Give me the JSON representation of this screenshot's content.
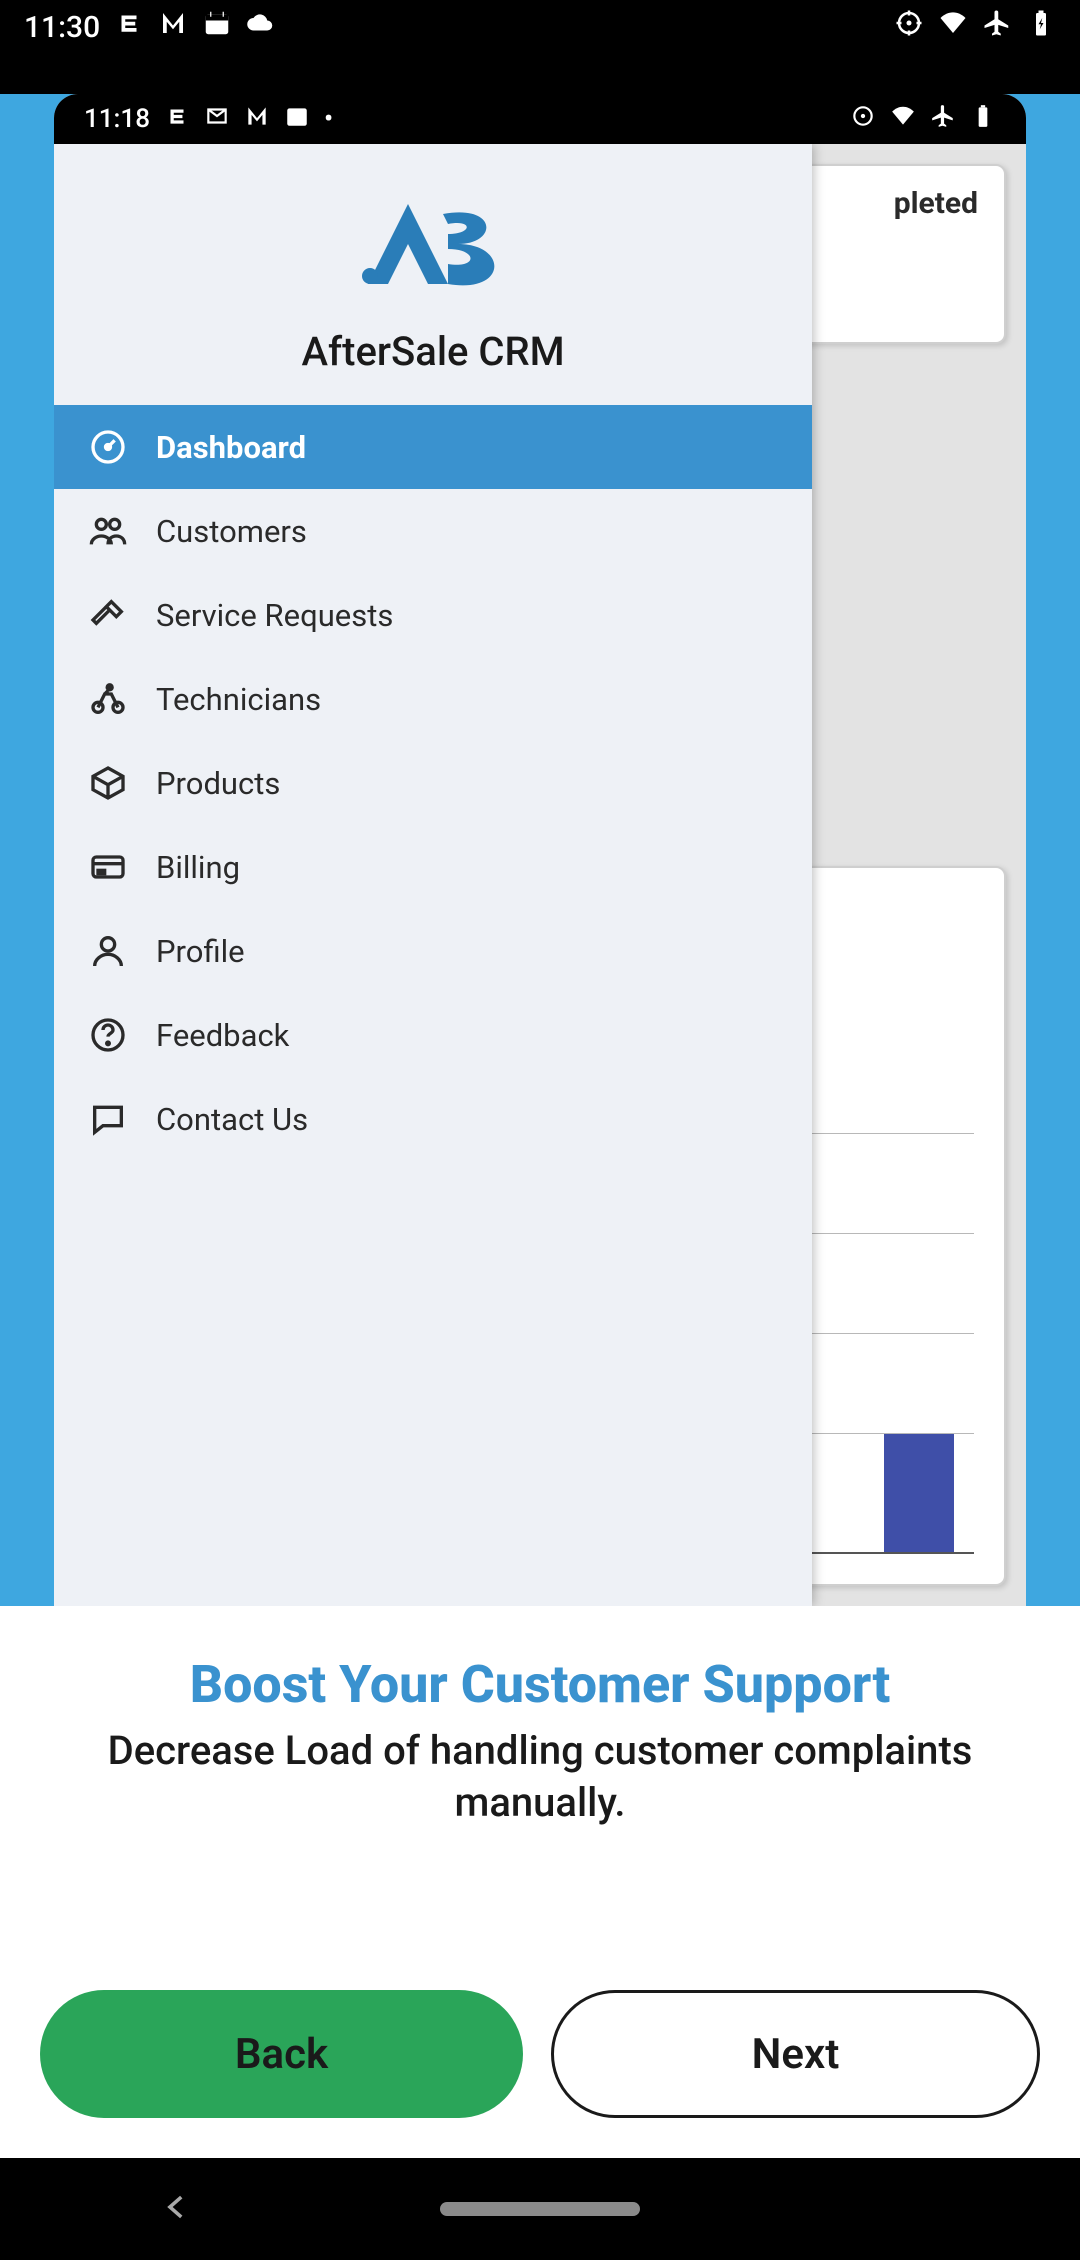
{
  "outer_status": {
    "time": "11:30",
    "icons_left": [
      "s",
      "m",
      "cal",
      "cloud"
    ]
  },
  "inner_status": {
    "time": "11:18"
  },
  "app_name": "AfterSale CRM",
  "bg_card_label": "pleted",
  "sidebar": {
    "items": [
      {
        "label": "Dashboard",
        "icon": "gauge-icon",
        "active": true
      },
      {
        "label": "Customers",
        "icon": "users-icon",
        "active": false
      },
      {
        "label": "Service Requests",
        "icon": "hammer-icon",
        "active": false
      },
      {
        "label": "Technicians",
        "icon": "bike-icon",
        "active": false
      },
      {
        "label": "Products",
        "icon": "box-icon",
        "active": false
      },
      {
        "label": "Billing",
        "icon": "card-icon",
        "active": false
      },
      {
        "label": "Profile",
        "icon": "person-icon",
        "active": false
      },
      {
        "label": "Feedback",
        "icon": "help-icon",
        "active": false
      },
      {
        "label": "Contact Us",
        "icon": "chat-icon",
        "active": false
      }
    ]
  },
  "onboarding": {
    "title": "Boost Your Customer Support",
    "subtitle": "Decrease Load of handling customer complaints manually.",
    "back_label": "Back",
    "next_label": "Next"
  },
  "colors": {
    "accent": "#3a92cf",
    "app_bg": "#3ea7e0",
    "primary_btn": "#2aa559"
  }
}
